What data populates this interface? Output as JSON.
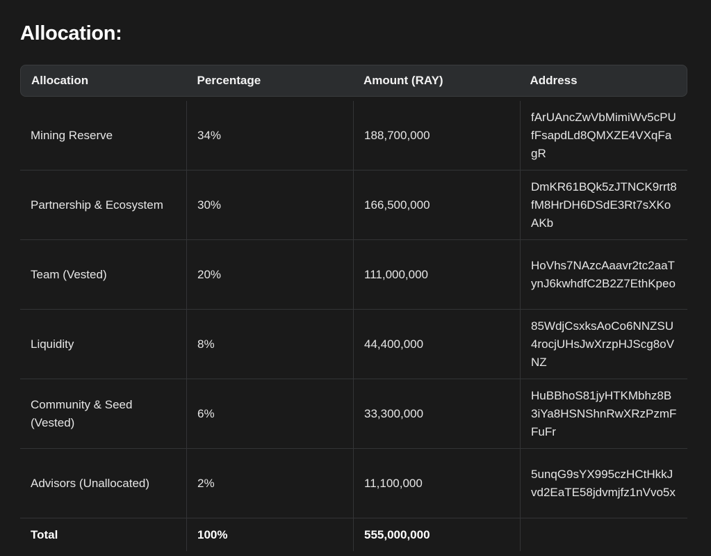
{
  "title": "Allocation:",
  "table": {
    "headers": [
      "Allocation",
      "Percentage",
      "Amount (RAY)",
      "Address"
    ],
    "rows": [
      {
        "allocation": "Mining Reserve",
        "percentage": "34%",
        "amount": "188,700,000",
        "address": "fArUAncZwVbMimiWv5cPUfFsapdLd8QMXZE4VXqFagR"
      },
      {
        "allocation": "Partnership & Ecosystem",
        "percentage": "30%",
        "amount": "166,500,000",
        "address": "DmKR61BQk5zJTNCK9rrt8fM8HrDH6DSdE3Rt7sXKoAKb"
      },
      {
        "allocation": "Team (Vested)",
        "percentage": "20%",
        "amount": "111,000,000",
        "address": "HoVhs7NAzcAaavr2tc2aaTynJ6kwhdfC2B2Z7EthKpeo"
      },
      {
        "allocation": "Liquidity",
        "percentage": "8%",
        "amount": "44,400,000",
        "address": "85WdjCsxksAoCo6NNZSU4rocjUHsJwXrzpHJScg8oVNZ"
      },
      {
        "allocation": "Community & Seed (Vested)",
        "percentage": "6%",
        "amount": "33,300,000",
        "address": "HuBBhoS81jyHTKMbhz8B3iYa8HSNShnRwXRzPzmFFuFr"
      },
      {
        "allocation": "Advisors (Unallocated)",
        "percentage": "2%",
        "amount": "11,100,000",
        "address": "5unqG9sYX995czHCtHkkJvd2EaTE58jdvmjfz1nVvo5x"
      }
    ],
    "total": {
      "allocation": "Total",
      "percentage": "100%",
      "amount": "555,000,000",
      "address": ""
    }
  }
}
